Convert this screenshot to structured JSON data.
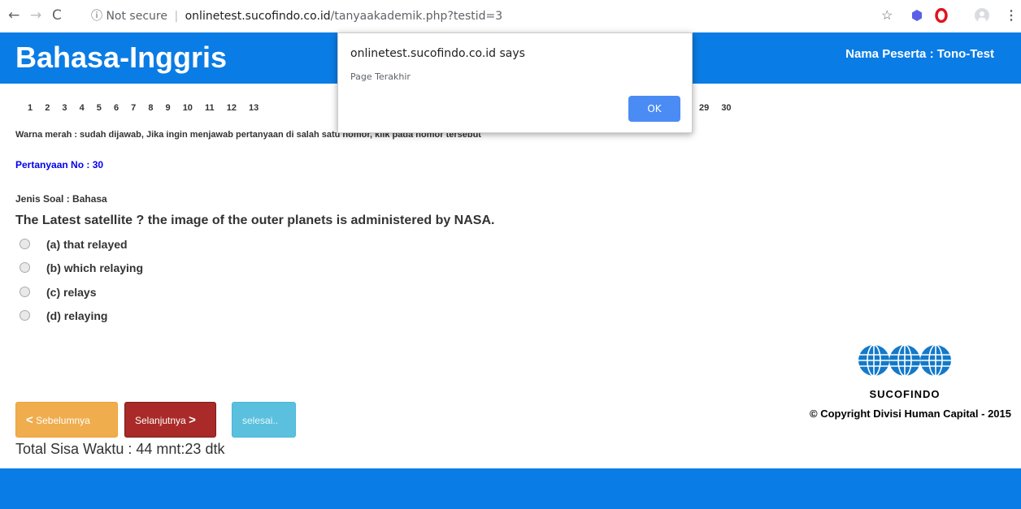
{
  "browser": {
    "back": "←",
    "forward": "→",
    "reload": "C",
    "security_icon": "ⓘ",
    "security_label": "Not secure",
    "url_domain": "onlinetest.sucofindo.co.id",
    "url_path": "/tanyaakademik.php?testid=3",
    "star": "☆"
  },
  "header": {
    "title": "Bahasa-Inggris",
    "participant": "Nama Peserta : Tono-Test",
    "bg_color": "#0a7ce5"
  },
  "question_numbers_start": [
    "1",
    "2",
    "3",
    "4",
    "5",
    "6",
    "7",
    "8",
    "9",
    "10",
    "11",
    "12",
    "13"
  ],
  "question_numbers_end": [
    "29",
    "30"
  ],
  "hint": "Warna merah : sudah dijawab, Jika ingin menjawab pertanyaan di salah satu nomor, klik pada nomor tersebut",
  "question": {
    "number_label": "Pertanyaan No : 30",
    "type_label": "Jenis Soal : Bahasa",
    "text": "The Latest satellite ? the image of the outer planets is administered by NASA.",
    "options": [
      "(a) that relayed",
      "(b) which relaying",
      "(c) relays",
      "(d) relaying"
    ]
  },
  "buttons": {
    "prev": "Sebelumnya",
    "next": "Selanjutnya",
    "done": "selesai..",
    "prev_arrow": "<",
    "next_arrow": ">"
  },
  "timer": "Total Sisa Waktu : 44 mnt:23 dtk",
  "logo_text": "SUCOFINDO",
  "copyright": "© Copyright Divisi Human Capital - 2015",
  "dialog": {
    "title": "onlinetest.sucofindo.co.id says",
    "message": "Page Terakhir",
    "ok": "OK"
  }
}
